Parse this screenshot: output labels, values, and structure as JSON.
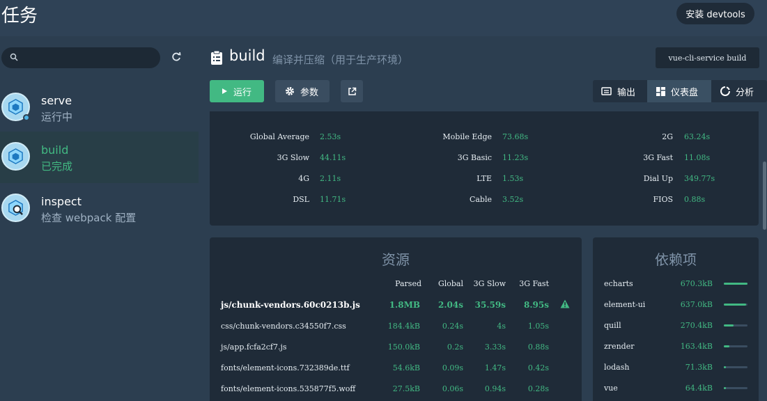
{
  "header": {
    "title": "任务",
    "devtools_button": "安装 devtools"
  },
  "sidebar": {
    "search": {
      "placeholder": "",
      "value": ""
    },
    "tasks": [
      {
        "name": "serve",
        "status": "运行中",
        "running": true
      },
      {
        "name": "build",
        "status": "已完成",
        "active": true
      },
      {
        "name": "inspect",
        "status": "检查 webpack 配置"
      }
    ]
  },
  "task_detail": {
    "title": "build",
    "description": "编译并压缩（用于生产环境）",
    "command": "vue-cli-service build",
    "run_label": "运行",
    "params_label": "参数",
    "views": {
      "output": "输出",
      "dashboard": "仪表盘",
      "analyze": "分析"
    }
  },
  "speed_stats": [
    {
      "label": "Global Average",
      "value": "2.53s"
    },
    {
      "label": "Mobile Edge",
      "value": "73.68s"
    },
    {
      "label": "2G",
      "value": "63.24s"
    },
    {
      "label": "3G Slow",
      "value": "44.11s"
    },
    {
      "label": "3G Basic",
      "value": "11.23s"
    },
    {
      "label": "3G Fast",
      "value": "11.08s"
    },
    {
      "label": "4G",
      "value": "2.11s"
    },
    {
      "label": "LTE",
      "value": "1.53s"
    },
    {
      "label": "Dial Up",
      "value": "349.77s"
    },
    {
      "label": "DSL",
      "value": "11.71s"
    },
    {
      "label": "Cable",
      "value": "3.52s"
    },
    {
      "label": "FIOS",
      "value": "0.88s"
    }
  ],
  "assets": {
    "title": "资源",
    "columns": [
      "Parsed",
      "Global",
      "3G Slow",
      "3G Fast"
    ],
    "rows": [
      {
        "name": "js/chunk-vendors.60c0213b.js",
        "parsed": "1.8MB",
        "global": "2.04s",
        "slow": "35.59s",
        "fast": "8.95s",
        "big": true
      },
      {
        "name": "css/chunk-vendors.c34550f7.css",
        "parsed": "184.4kB",
        "global": "0.24s",
        "slow": "4s",
        "fast": "1.05s"
      },
      {
        "name": "js/app.fcfa2cf7.js",
        "parsed": "150.0kB",
        "global": "0.2s",
        "slow": "3.33s",
        "fast": "0.88s"
      },
      {
        "name": "fonts/element-icons.732389de.ttf",
        "parsed": "54.6kB",
        "global": "0.09s",
        "slow": "1.47s",
        "fast": "0.42s"
      },
      {
        "name": "fonts/element-icons.535877f5.woff",
        "parsed": "27.5kB",
        "global": "0.06s",
        "slow": "0.94s",
        "fast": "0.28s"
      }
    ]
  },
  "dependencies": {
    "title": "依赖项",
    "rows": [
      {
        "name": "echarts",
        "size": "670.3kB",
        "ratio": 1.0
      },
      {
        "name": "element-ui",
        "size": "637.0kB",
        "ratio": 0.95
      },
      {
        "name": "quill",
        "size": "270.4kB",
        "ratio": 0.4
      },
      {
        "name": "zrender",
        "size": "163.4kB",
        "ratio": 0.24
      },
      {
        "name": "lodash",
        "size": "71.3kB",
        "ratio": 0.1
      },
      {
        "name": "vue",
        "size": "64.4kB",
        "ratio": 0.09
      }
    ]
  },
  "colors": {
    "accent": "#42b983",
    "panel": "#1f2b38",
    "background": "#2c3e50"
  },
  "icons": [
    "search-icon",
    "refresh-icon",
    "webpack-cube-icon",
    "clipboard-icon",
    "play-icon",
    "gear-icon",
    "external-link-icon",
    "terminal-icon",
    "dashboard-icon",
    "pie-chart-icon",
    "warning-icon"
  ]
}
